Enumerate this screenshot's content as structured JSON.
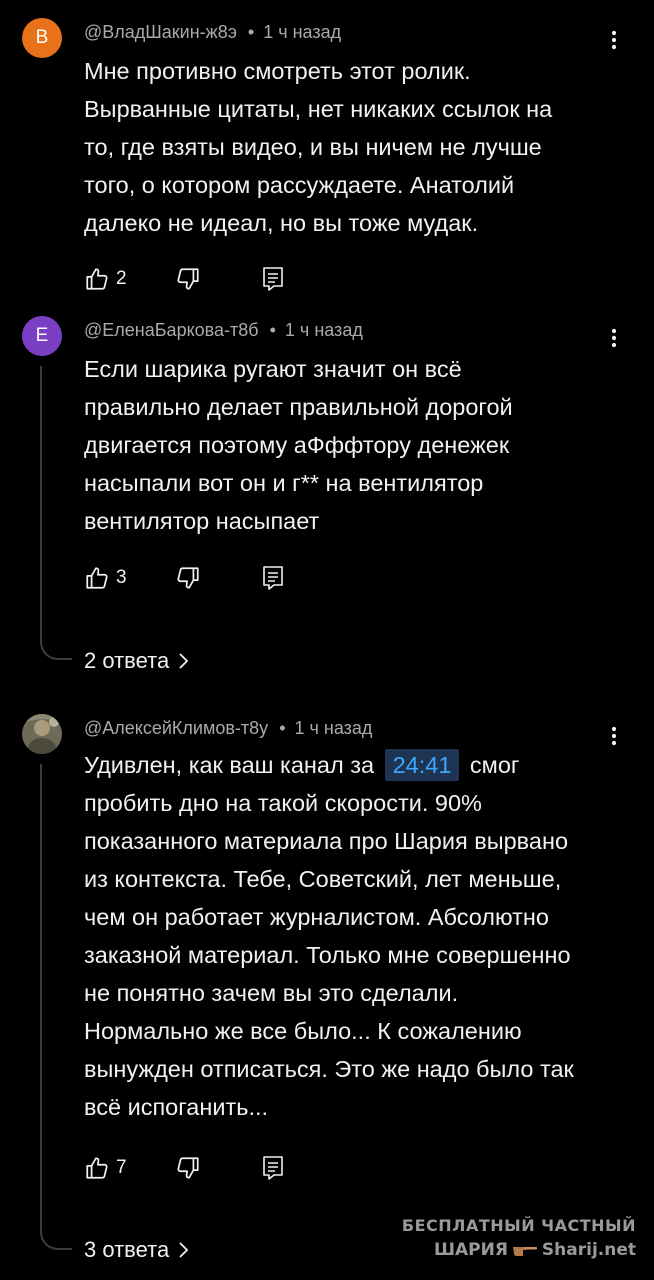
{
  "comments": [
    {
      "avatar_letter": "В",
      "avatar_color": "#e8711a",
      "author": "@ВладШакин-ж8э",
      "time": "1 ч назад",
      "lines": [
        "Мне противно смотреть этот ролик.",
        "Вырванные цитаты, нет никаких ссылок на",
        "то, где взяты видео, и вы ничем не лучше",
        "того, о котором рассуждаете. Анатолий",
        "далеко не идеал, но вы тоже мудак."
      ],
      "likes": "2"
    },
    {
      "avatar_letter": "Е",
      "avatar_color": "#7b3fc4",
      "author": "@ЕленаБаркова-т8б",
      "time": "1 ч назад",
      "lines": [
        "Если шарика ругают значит он всё",
        "правильно делает правильной дорогой",
        "двигается поэтому аФффтору денежек",
        "насыпали вот он и г** на вентилятор",
        "вентилятор насыпает"
      ],
      "likes": "3",
      "replies": "2 ответа"
    },
    {
      "author": "@АлексейКлимов-т8у",
      "time": "1 ч назад",
      "line1_before": "Удивлен, как ваш канал за",
      "timestamp": "24:41",
      "line1_after": "смог",
      "lines": [
        "пробить дно на такой скорости. 90%",
        "показанного материала про Шария вырвано",
        "из контекста. Тебе, Советский, лет меньше,",
        "чем он работает журналистом. Абсолютно",
        "заказной материал. Только мне совершенно",
        "не понятно зачем вы это сделали.",
        "Нормально же все было... К сожалению",
        "вынужден отписаться. Это же надо было так",
        "всё испоганить..."
      ],
      "likes": "7",
      "replies": "3 ответа"
    }
  ],
  "watermark": {
    "line1": "БЕСПЛАТНЫЙ ЧАСТНЫЙ",
    "line2_left": "ШАРИЯ",
    "line2_right": "Sharij.net"
  },
  "colors": {
    "background": "#000000",
    "text": "#f1f1f1",
    "meta": "#aaaaaa",
    "timestamp_link": "#3ea6ff",
    "thread_line": "#3d3d3d"
  },
  "icons": [
    "like-icon",
    "dislike-icon",
    "reply-icon",
    "more-vert-icon",
    "chevron-right-icon"
  ]
}
